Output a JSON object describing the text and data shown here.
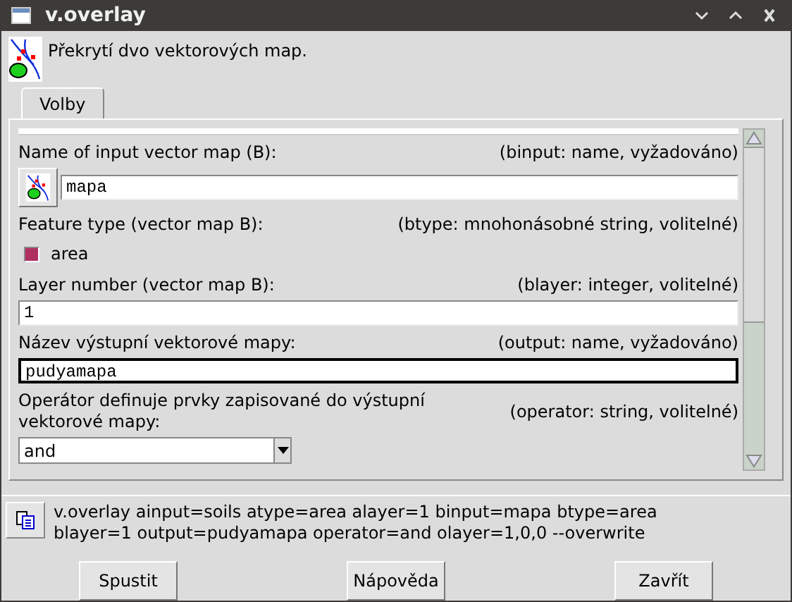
{
  "window": {
    "title": "v.overlay"
  },
  "description": "Překrytí dvo vektorových map.",
  "tabs": [
    {
      "label": "Volby",
      "selected": true
    }
  ],
  "fields": [
    {
      "kind": "map_input",
      "label": "Name of input vector map (B):",
      "info": "(binput:  name, vyžadováno)",
      "value": "mapa",
      "focused": false
    },
    {
      "kind": "checkbox",
      "label": "Feature type (vector map B):",
      "info": "(btype: mnohonásobné string, volitelné)",
      "option": "area",
      "checked": true
    },
    {
      "kind": "input",
      "label": "Layer number (vector map B):",
      "info": "(blayer:  integer, volitelné)",
      "value": "1",
      "focused": false
    },
    {
      "kind": "input",
      "label": "Název výstupní vektorové mapy:",
      "info": "(output:  name, vyžadováno)",
      "value": "pudyamapa",
      "focused": true
    },
    {
      "kind": "select",
      "label": "Operátor definuje prvky zapisované do výstupní vektorové mapy:",
      "info": "(operator:  string, volitelné)",
      "value": "and"
    }
  ],
  "command": "v.overlay ainput=soils atype=area alayer=1 binput=mapa btype=area blayer=1 output=pudyamapa operator=and olayer=1,0,0 --overwrite",
  "buttons": [
    "Spustit",
    "Nápověda",
    "Zavřít"
  ]
}
